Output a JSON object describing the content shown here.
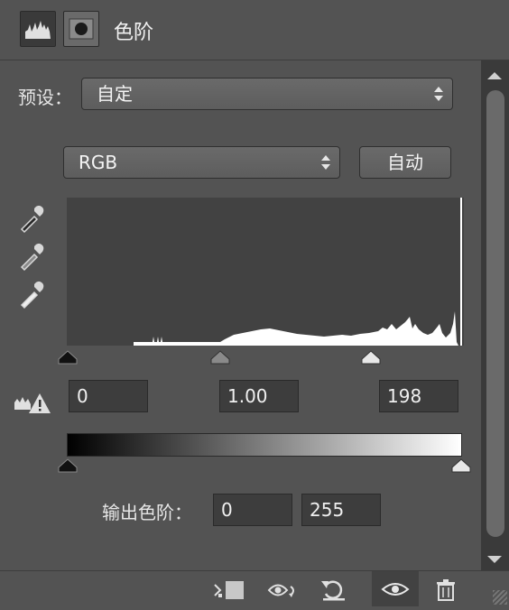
{
  "header": {
    "title": "色阶"
  },
  "preset": {
    "label": "预设：",
    "value": "自定"
  },
  "channel": {
    "value": "RGB",
    "auto_label": "自动"
  },
  "input_levels": {
    "black": "0",
    "gamma": "1.00",
    "white": "198"
  },
  "output_levels": {
    "label": "输出色阶：",
    "black": "0",
    "white": "255"
  },
  "icons": {
    "histogram_tab": "histogram-icon",
    "mask_tab": "mask-icon",
    "eyedropper_black": "eyedropper-icon",
    "eyedropper_gray": "eyedropper-icon",
    "eyedropper_white": "eyedropper-icon",
    "warning": "clipping-warning-icon",
    "clip": "clip-to-layer-icon",
    "view_previous": "view-previous-icon",
    "reset": "reset-icon",
    "visibility": "eye-icon",
    "delete": "trash-icon"
  },
  "colors": {
    "panel_bg": "#535353",
    "field_bg": "#3d3d3d",
    "histogram_bg": "#424242"
  }
}
